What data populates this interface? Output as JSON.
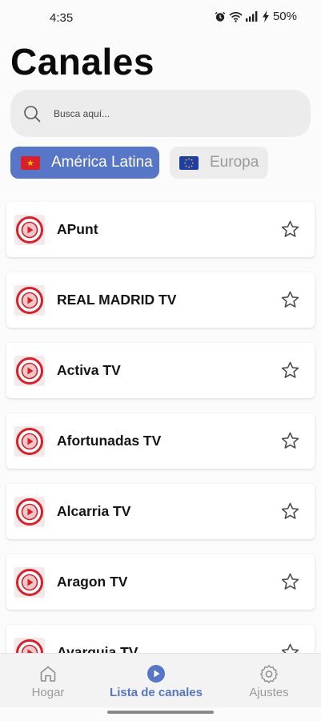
{
  "status_bar": {
    "time": "4:35",
    "battery": "50%",
    "icons": [
      "alarm-icon",
      "wifi-icon",
      "signal-icon",
      "charging-icon"
    ]
  },
  "page": {
    "title": "Canales"
  },
  "search": {
    "placeholder": "Busca aquí..."
  },
  "regions": [
    {
      "label": "América Latina",
      "flag": "latam-flag",
      "selected": true
    },
    {
      "label": "Europa",
      "flag": "eu-flag",
      "selected": false
    }
  ],
  "channels": [
    {
      "name": "APunt"
    },
    {
      "name": "REAL MADRID TV"
    },
    {
      "name": "Activa TV"
    },
    {
      "name": "Afortunadas TV"
    },
    {
      "name": "Alcarria TV"
    },
    {
      "name": "Aragon TV"
    },
    {
      "name": "Avarquia TV"
    }
  ],
  "bottom_nav": [
    {
      "label": "Hogar",
      "icon": "home-icon",
      "active": false
    },
    {
      "label": "Lista de canales",
      "icon": "play-icon",
      "active": true
    },
    {
      "label": "Ajustes",
      "icon": "gear-icon",
      "active": false
    }
  ],
  "colors": {
    "accent": "#5876c7",
    "logo_red": "#d8202b",
    "background": "#fbfbfc",
    "chip_inactive": "#ececed"
  }
}
